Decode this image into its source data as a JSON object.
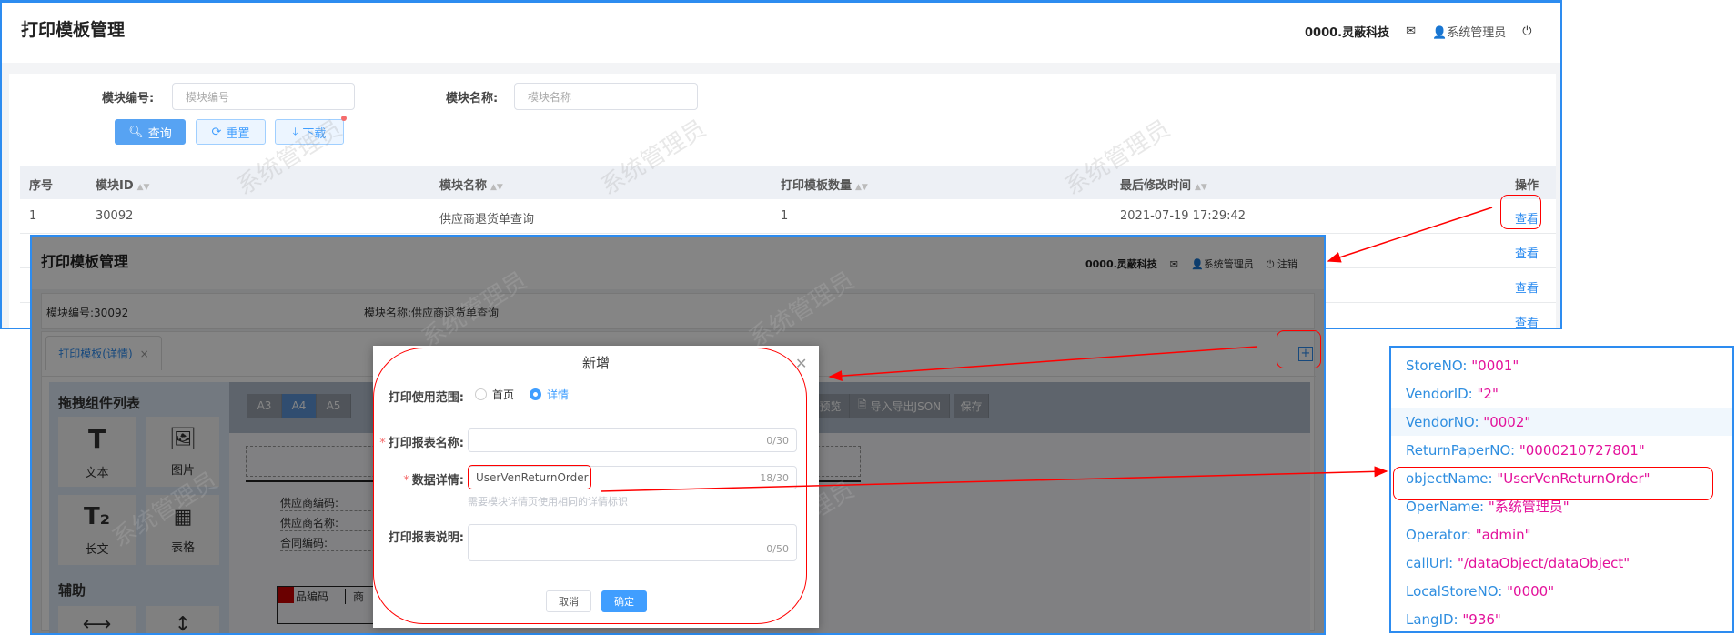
{
  "app": {
    "title": "打印模板管理",
    "company": "0000.灵蔽科技",
    "user": "系统管理员",
    "logout": "注销",
    "watermark": "系统管理员"
  },
  "search": {
    "code_label": "模块编号:",
    "code_placeholder": "模块编号",
    "name_label": "模块名称:",
    "name_placeholder": "模块名称",
    "query": "查询",
    "reset": "重置",
    "download": "下载"
  },
  "table": {
    "headers": [
      "序号",
      "模块ID",
      "模块名称",
      "打印模板数量",
      "最后修改时间",
      "操作"
    ],
    "rows": [
      {
        "index": "1",
        "id": "30092",
        "name": "供应商退货单查询",
        "count": "1",
        "modified": "2021-07-19 17:29:42",
        "action": "查看"
      }
    ],
    "more_actions": [
      "查看",
      "查看",
      "查看"
    ]
  },
  "detail": {
    "module_code": "模块编号:30092",
    "module_name": "模块名称:供应商退货单查询",
    "tab": "打印模板(详情)",
    "tab_close": "×",
    "components_title": "拖拽组件列表",
    "components": [
      "文本",
      "图片",
      "长文",
      "表格"
    ],
    "aux_title": "辅助",
    "paper_sizes": [
      "A3",
      "A4",
      "A5"
    ],
    "selected_paper": "A4",
    "toolbar": [
      "预览",
      "导入导出JSON",
      "保存"
    ],
    "paper_fields": [
      "供应商编码:",
      "供应商名称:",
      "合同编码:"
    ],
    "paper_table_header": "品编码",
    "paper_table_header2": "商"
  },
  "modal": {
    "title": "新增",
    "scope_label": "打印使用范围:",
    "scope_options": [
      "首页",
      "详情"
    ],
    "scope_selected": "详情",
    "report_name_label": "打印报表名称:",
    "report_name_value": "",
    "report_name_count": "0/30",
    "data_detail_label": "数据详情:",
    "data_detail_value": "UserVenReturnOrder",
    "data_detail_count": "18/30",
    "data_detail_hint": "需要模块详情页使用相同的详情标识",
    "desc_label": "打印报表说明:",
    "desc_count": "0/50",
    "cancel": "取消",
    "confirm": "确定"
  },
  "json_panel": [
    {
      "key": "StoreNO:",
      "value": "\"0001\""
    },
    {
      "key": "VendorID:",
      "value": "\"2\""
    },
    {
      "key": "VendorNO:",
      "value": "\"0002\""
    },
    {
      "key": "ReturnPaperNO:",
      "value": "\"0000210727801\""
    },
    {
      "key": "objectName:",
      "value": "\"UserVenReturnOrder\""
    },
    {
      "key": "OperName:",
      "value": "\"系统管理员\""
    },
    {
      "key": "Operator:",
      "value": "\"admin\""
    },
    {
      "key": "callUrl:",
      "value": "\"/dataObject/dataObject\""
    },
    {
      "key": "LocalStoreNO:",
      "value": "\"0000\""
    },
    {
      "key": "LangID:",
      "value": "\"936\""
    }
  ],
  "colors": {
    "primary": "#2d8cf0",
    "annotation": "#ff0000",
    "json_key": "#2f8ee0",
    "json_value": "#e3119b"
  }
}
